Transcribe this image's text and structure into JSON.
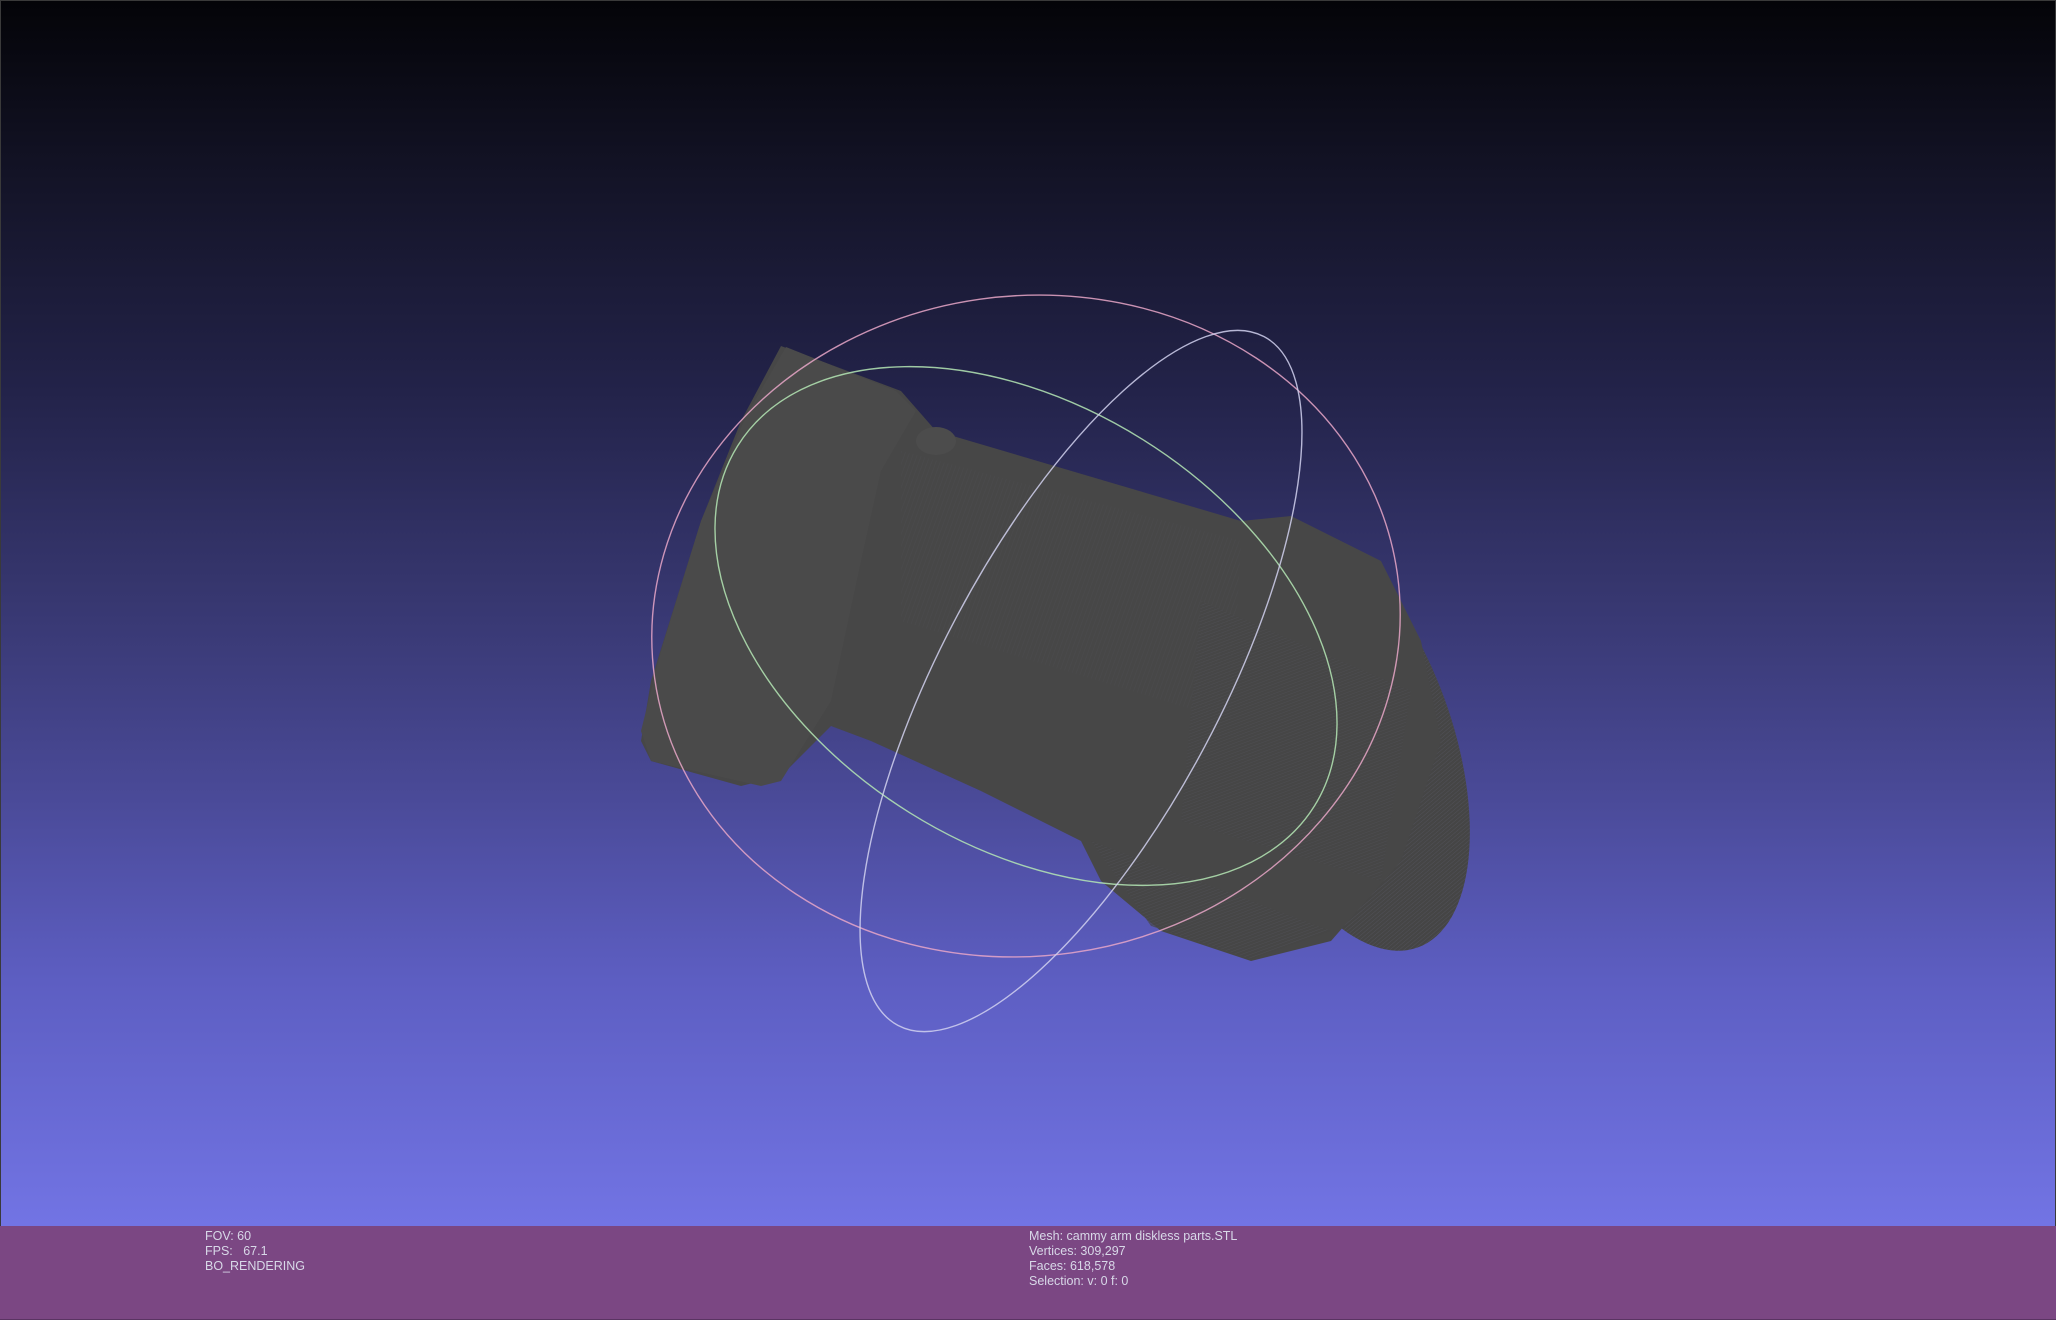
{
  "viewer": {
    "info_left": {
      "fov": "FOV: 60",
      "fps": "FPS:   67.1",
      "render_mode": "BO_RENDERING"
    },
    "info_right": {
      "mesh": "Mesh: cammy arm diskless parts.STL",
      "vertices": "Vertices: 309,297",
      "faces": "Faces: 618,578",
      "selection": "Selection: v: 0 f: 0"
    }
  },
  "colors": {
    "background_top": "#040408",
    "background_bottom": "#7274e4",
    "mesh": "#474747",
    "info_bar": "#7b4783",
    "trackball_red": "#e9a7c8",
    "trackball_green": "#b5e8b5",
    "trackball_blue": "#d2d2f0"
  },
  "icons": [
    "trackball-gizmo"
  ]
}
